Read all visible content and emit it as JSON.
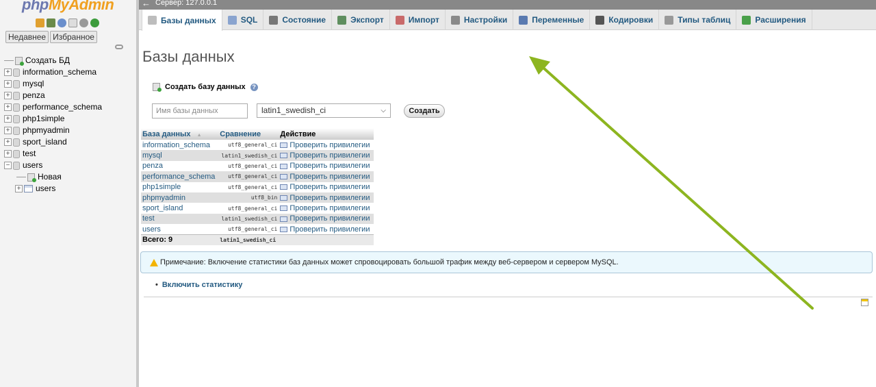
{
  "nav": {
    "logo_part1": "php",
    "logo_part2": "MyAdmin",
    "recent_label": "Недавнее",
    "favorites_label": "Избранное",
    "create_db_label": "Создать БД",
    "databases": [
      "information_schema",
      "mysql",
      "penza",
      "performance_schema",
      "php1simple",
      "phpmyadmin",
      "sport_island",
      "test",
      "users"
    ],
    "users_children": {
      "new_label": "Новая",
      "table_label": "users"
    }
  },
  "server_bar": {
    "back": "←",
    "label": "Сервер: 127.0.0.1"
  },
  "tabs": [
    {
      "label": "Базы данных",
      "icon": "database-icon",
      "color": "#bdbdbd"
    },
    {
      "label": "SQL",
      "icon": "sql-icon",
      "color": "#8aa4cf"
    },
    {
      "label": "Состояние",
      "icon": "status-icon",
      "color": "#777777"
    },
    {
      "label": "Экспорт",
      "icon": "export-icon",
      "color": "#5f8e5f"
    },
    {
      "label": "Импорт",
      "icon": "import-icon",
      "color": "#c96a6a"
    },
    {
      "label": "Настройки",
      "icon": "wrench-icon",
      "color": "#8a8a8a"
    },
    {
      "label": "Переменные",
      "icon": "variables-icon",
      "color": "#5a7ab0"
    },
    {
      "label": "Кодировки",
      "icon": "charset-icon",
      "color": "#555555"
    },
    {
      "label": "Типы таблиц",
      "icon": "engines-icon",
      "color": "#999999"
    },
    {
      "label": "Расширения",
      "icon": "puzzle-icon",
      "color": "#4aa04a"
    }
  ],
  "main": {
    "title": "Базы данных",
    "create_label": "Создать базу данных",
    "help": "?",
    "dbname_placeholder": "Имя базы данных",
    "collation_selected": "latin1_swedish_ci",
    "create_button": "Создать",
    "table": {
      "headers": {
        "name": "База данных",
        "sort": "▲",
        "collation": "Сравнение",
        "action": "Действие"
      },
      "rows": [
        {
          "name": "information_schema",
          "collation": "utf8_general_ci",
          "action": "Проверить привилегии"
        },
        {
          "name": "mysql",
          "collation": "latin1_swedish_ci",
          "action": "Проверить привилегии"
        },
        {
          "name": "penza",
          "collation": "utf8_general_ci",
          "action": "Проверить привилегии"
        },
        {
          "name": "performance_schema",
          "collation": "utf8_general_ci",
          "action": "Проверить привилегии"
        },
        {
          "name": "php1simple",
          "collation": "utf8_general_ci",
          "action": "Проверить привилегии"
        },
        {
          "name": "phpmyadmin",
          "collation": "utf8_bin",
          "action": "Проверить привилегии"
        },
        {
          "name": "sport_island",
          "collation": "utf8_general_ci",
          "action": "Проверить привилегии"
        },
        {
          "name": "test",
          "collation": "latin1_swedish_ci",
          "action": "Проверить привилегии"
        },
        {
          "name": "users",
          "collation": "utf8_general_ci",
          "action": "Проверить привилегии"
        }
      ],
      "total_label": "Всего: 9",
      "total_collation": "latin1_swedish_ci"
    },
    "note": "Примечание: Включение статистики баз данных может спровоцировать большой трафик между веб-сервером и сервером MySQL.",
    "enable_stats": "Включить статистику"
  },
  "colors": {
    "link": "#235a81",
    "arrow": "#8db520",
    "note_bg": "#ebf8fd"
  }
}
